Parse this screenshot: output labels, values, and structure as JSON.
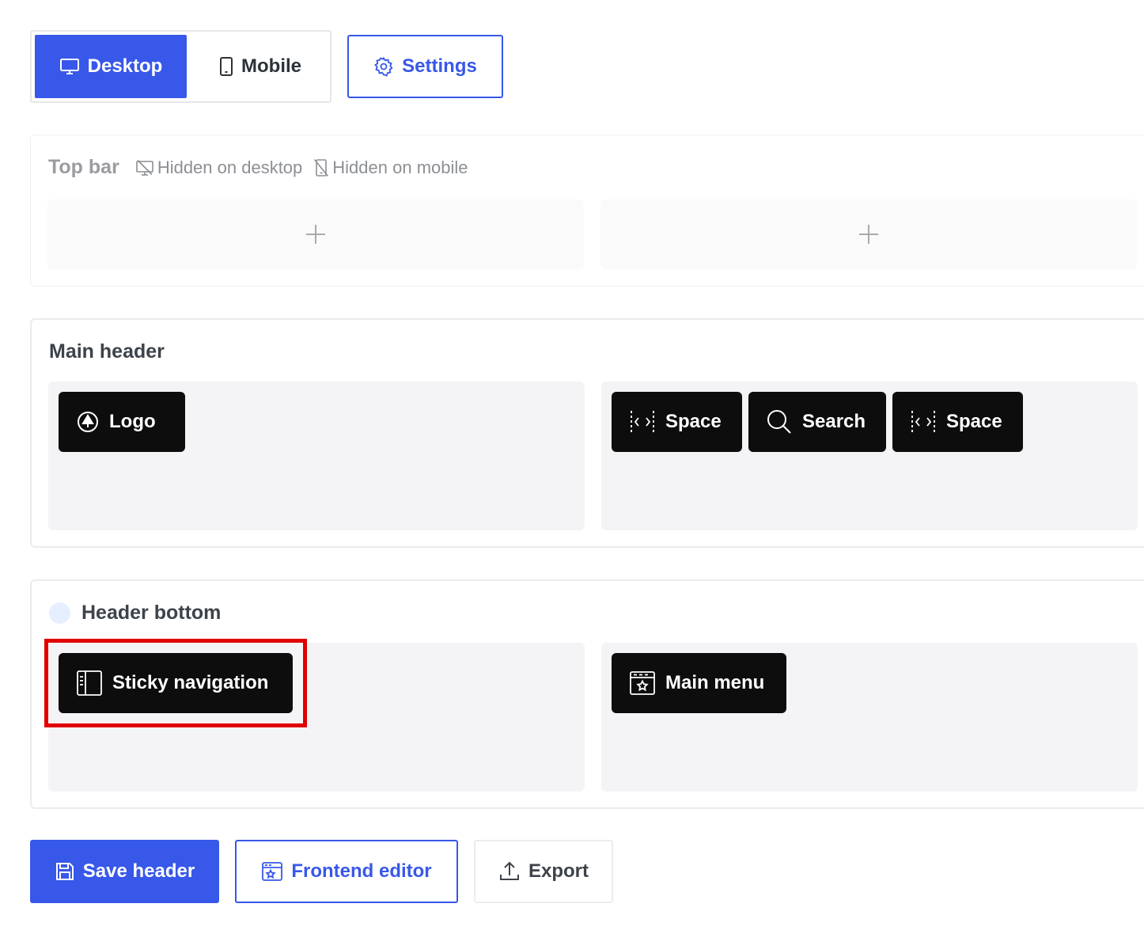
{
  "toolbar": {
    "desktop_label": "Desktop",
    "mobile_label": "Mobile",
    "settings_label": "Settings",
    "active_device": "Desktop"
  },
  "sections": {
    "top_bar": {
      "title": "Top bar",
      "hidden_desktop": "Hidden on desktop",
      "hidden_mobile": "Hidden on mobile"
    },
    "main_header": {
      "title": "Main header",
      "left_items": [
        {
          "label": "Logo",
          "icon": "logo-icon"
        }
      ],
      "right_items": [
        {
          "label": "Space",
          "icon": "space-icon"
        },
        {
          "label": "Search",
          "icon": "search-icon"
        },
        {
          "label": "Space",
          "icon": "space-icon"
        }
      ]
    },
    "header_bottom": {
      "title": "Header bottom",
      "left_items": [
        {
          "label": "Sticky navigation",
          "icon": "sidebar-panel-icon"
        }
      ],
      "right_items": [
        {
          "label": "Main menu",
          "icon": "menu-window-icon"
        }
      ]
    }
  },
  "actions": {
    "save_label": "Save header",
    "frontend_label": "Frontend editor",
    "export_label": "Export"
  },
  "colors": {
    "accent": "#3858e9",
    "chip_bg": "#0d0d0d",
    "highlight": "#e00000",
    "zone_bg": "#f4f4f6"
  }
}
